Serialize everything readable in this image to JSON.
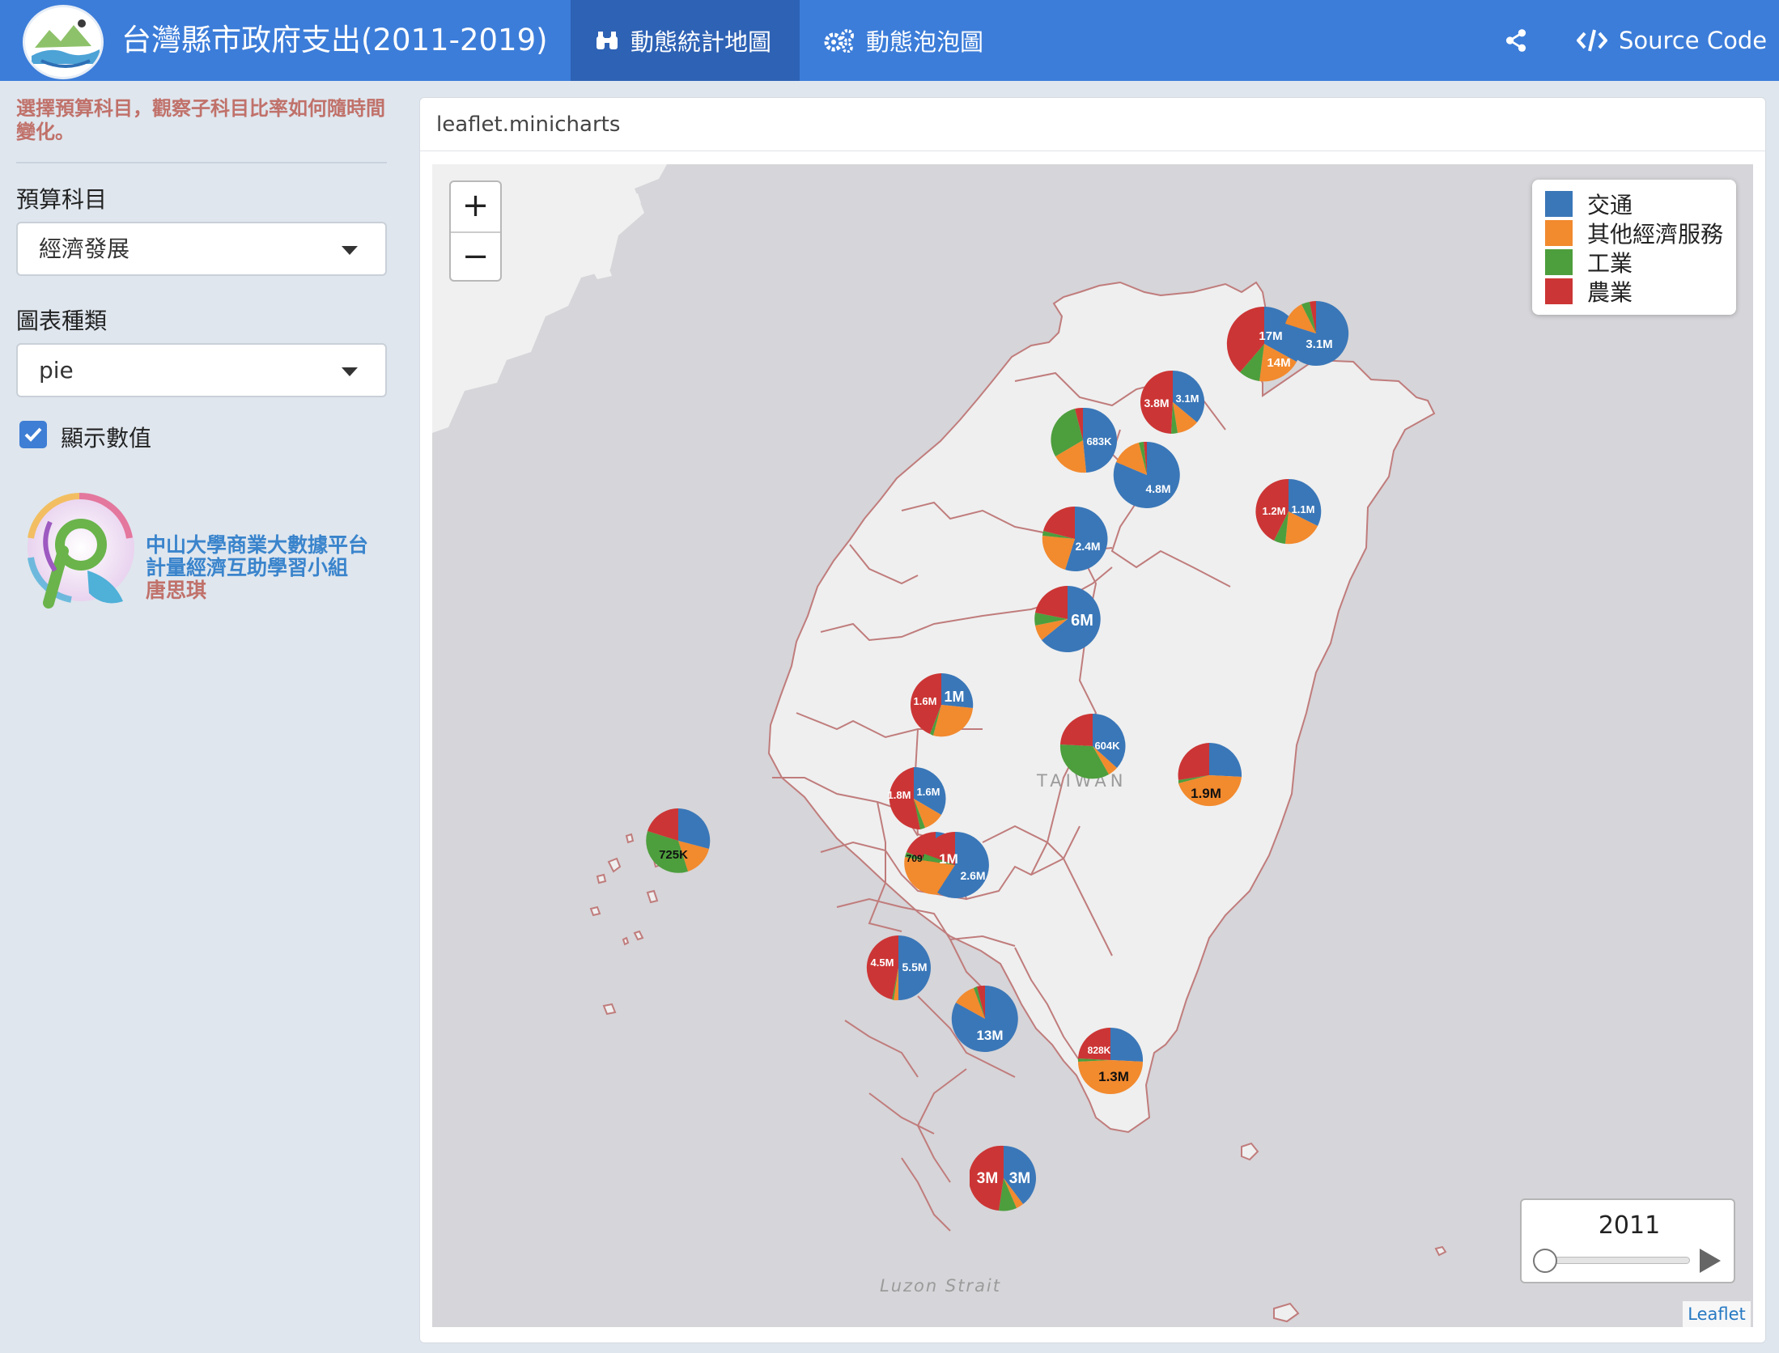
{
  "header": {
    "title": "台灣縣市政府支出(2011-2019)",
    "tabs": [
      {
        "label": "動態統計地圖",
        "icon": "binoculars-icon"
      },
      {
        "label": "動態泡泡圖",
        "icon": "gears-icon"
      }
    ],
    "share_icon": "share-icon",
    "source_code_label": "Source Code",
    "source_code_icon": "code-icon",
    "brand_color": "#3c7dd9"
  },
  "sidebar": {
    "hint": "選擇預算科目，觀察子科目比率如何隨時間變化。",
    "budget_label": "預算科目",
    "budget_value": "經濟發展",
    "chart_type_label": "圖表種類",
    "chart_type_value": "pie",
    "show_values_label": "顯示數值",
    "show_values_checked": true,
    "org_line1": "中山大學商業大數據平台",
    "org_line2": "計量經濟互助學習小組",
    "org_line3": "唐思琪"
  },
  "panel": {
    "title": "leaflet.minicharts"
  },
  "map": {
    "zoom_in": "+",
    "zoom_out": "−",
    "legend": [
      {
        "label": "交通",
        "color": "#3a77b8"
      },
      {
        "label": "其他經濟服務",
        "color": "#f28a2e"
      },
      {
        "label": "工業",
        "color": "#4d9e3d"
      },
      {
        "label": "農業",
        "color": "#cc3535"
      }
    ],
    "year": "2011",
    "attribution": "Leaflet",
    "place_taiwan": "TAIWAN",
    "place_luzon": "Luzon Strait"
  }
}
